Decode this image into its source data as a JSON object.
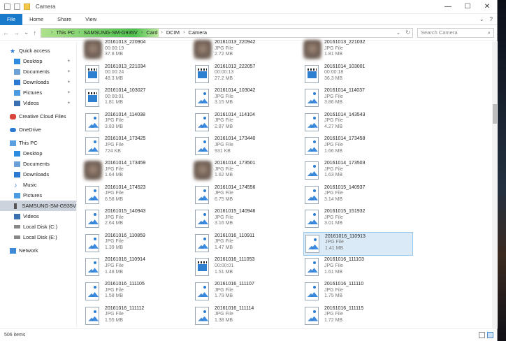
{
  "window": {
    "title": "Camera",
    "minimize": "—",
    "maximize": "☐",
    "close": "✕"
  },
  "ribbon": {
    "file": "File",
    "home": "Home",
    "share": "Share",
    "view": "View",
    "expand": "⌄",
    "help": "?"
  },
  "address": {
    "back": "←",
    "forward": "→",
    "recent": "⌄",
    "up": "↑",
    "crumbs": [
      "This PC",
      "SAMSUNG-SM-G935V",
      "Card",
      "DCIM",
      "Camera"
    ],
    "sep": "›",
    "dropdown": "⌄",
    "refresh": "↻",
    "search_placeholder": "Search Camera",
    "search_icon": "⌕"
  },
  "sidebar": {
    "quick_access": "Quick access",
    "qa_items": [
      {
        "label": "Desktop",
        "pinned": true
      },
      {
        "label": "Documents",
        "pinned": true
      },
      {
        "label": "Downloads",
        "pinned": true
      },
      {
        "label": "Pictures",
        "pinned": true
      },
      {
        "label": "Videos",
        "pinned": true
      }
    ],
    "pin_glyph": "✦",
    "creative_cloud": "Creative Cloud Files",
    "onedrive": "OneDrive",
    "this_pc": "This PC",
    "pc_items": [
      "Desktop",
      "Documents",
      "Downloads",
      "Music",
      "Pictures",
      "SAMSUNG-SM-G935V",
      "Videos",
      "Local Disk (C:)",
      "Local Disk (E:)"
    ],
    "network": "Network"
  },
  "files": [
    [
      {
        "name": "20161013_220904",
        "type": "00:00:19",
        "size": "37.8 MB",
        "icon": "photo-thumb"
      },
      {
        "name": "20161013_220942",
        "type": "JPG File",
        "size": "2.72 MB",
        "icon": "photo-thumb"
      },
      {
        "name": "20161013_221032",
        "type": "JPG File",
        "size": "1.81 MB",
        "icon": "photo-thumb"
      }
    ],
    [
      {
        "name": "20161013_221034",
        "type": "00:00:24",
        "size": "48.3 MB",
        "icon": "video"
      },
      {
        "name": "20161013_222057",
        "type": "00:00:13",
        "size": "27.2 MB",
        "icon": "video"
      },
      {
        "name": "20161014_103001",
        "type": "00:00:18",
        "size": "36.3 MB",
        "icon": "video"
      }
    ],
    [
      {
        "name": "20161014_103027",
        "type": "00:00:01",
        "size": "1.81 MB",
        "icon": "video"
      },
      {
        "name": "20161014_103042",
        "type": "JPG File",
        "size": "3.15 MB",
        "icon": "image"
      },
      {
        "name": "20161014_114037",
        "type": "JPG File",
        "size": "3.86 MB",
        "icon": "image"
      }
    ],
    [
      {
        "name": "20161014_114038",
        "type": "JPG File",
        "size": "3.83 MB",
        "icon": "image"
      },
      {
        "name": "20161014_114104",
        "type": "JPG File",
        "size": "2.87 MB",
        "icon": "image"
      },
      {
        "name": "20161014_143543",
        "type": "JPG File",
        "size": "4.27 MB",
        "icon": "image"
      }
    ],
    [
      {
        "name": "20161014_173425",
        "type": "JPG File",
        "size": "724 KB",
        "icon": "image"
      },
      {
        "name": "20161014_173440",
        "type": "JPG File",
        "size": "931 KB",
        "icon": "image"
      },
      {
        "name": "20161014_173458",
        "type": "JPG File",
        "size": "1.66 MB",
        "icon": "image"
      }
    ],
    [
      {
        "name": "20161014_173459",
        "type": "JPG File",
        "size": "1.64 MB",
        "icon": "photo-thumb"
      },
      {
        "name": "20161014_173501",
        "type": "JPG File",
        "size": "1.62 MB",
        "icon": "photo-thumb"
      },
      {
        "name": "20161014_173503",
        "type": "JPG File",
        "size": "1.63 MB",
        "icon": "image"
      }
    ],
    [
      {
        "name": "20161014_174523",
        "type": "JPG File",
        "size": "6.58 MB",
        "icon": "image"
      },
      {
        "name": "20161014_174556",
        "type": "JPG File",
        "size": "6.75 MB",
        "icon": "image"
      },
      {
        "name": "20161015_140937",
        "type": "JPG File",
        "size": "3.14 MB",
        "icon": "image"
      }
    ],
    [
      {
        "name": "20161015_140943",
        "type": "JPG File",
        "size": "2.64 MB",
        "icon": "image"
      },
      {
        "name": "20161015_140946",
        "type": "JPG File",
        "size": "3.16 MB",
        "icon": "image"
      },
      {
        "name": "20161015_151932",
        "type": "JPG File",
        "size": "3.01 MB",
        "icon": "image"
      }
    ],
    [
      {
        "name": "20161016_110859",
        "type": "JPG File",
        "size": "1.39 MB",
        "icon": "image"
      },
      {
        "name": "20161016_110911",
        "type": "JPG File",
        "size": "1.47 MB",
        "icon": "image"
      },
      {
        "name": "20161016_110913",
        "type": "JPG File",
        "size": "1.41 MB",
        "icon": "image",
        "selected": true
      }
    ],
    [
      {
        "name": "20161016_110914",
        "type": "JPG File",
        "size": "1.48 MB",
        "icon": "image"
      },
      {
        "name": "20161016_111053",
        "type": "00:00:01",
        "size": "1.51 MB",
        "icon": "video"
      },
      {
        "name": "20161016_111103",
        "type": "JPG File",
        "size": "1.61 MB",
        "icon": "image"
      }
    ],
    [
      {
        "name": "20161016_111105",
        "type": "JPG File",
        "size": "1.58 MB",
        "icon": "image"
      },
      {
        "name": "20161016_111107",
        "type": "JPG File",
        "size": "1.79 MB",
        "icon": "image"
      },
      {
        "name": "20161016_111110",
        "type": "JPG File",
        "size": "1.75 MB",
        "icon": "image"
      }
    ],
    [
      {
        "name": "20161016_111112",
        "type": "JPG File",
        "size": "1.55 MB",
        "icon": "image"
      },
      {
        "name": "20161016_111114",
        "type": "JPG File",
        "size": "1.38 MB",
        "icon": "image"
      },
      {
        "name": "20161016_111115",
        "type": "JPG File",
        "size": "1.72 MB",
        "icon": "image"
      }
    ]
  ],
  "status": {
    "count": "506 items"
  },
  "colors": {
    "file_tab": "#1979ca",
    "selection": "#dbeaf7",
    "path_highlight": "#4ec24e"
  }
}
